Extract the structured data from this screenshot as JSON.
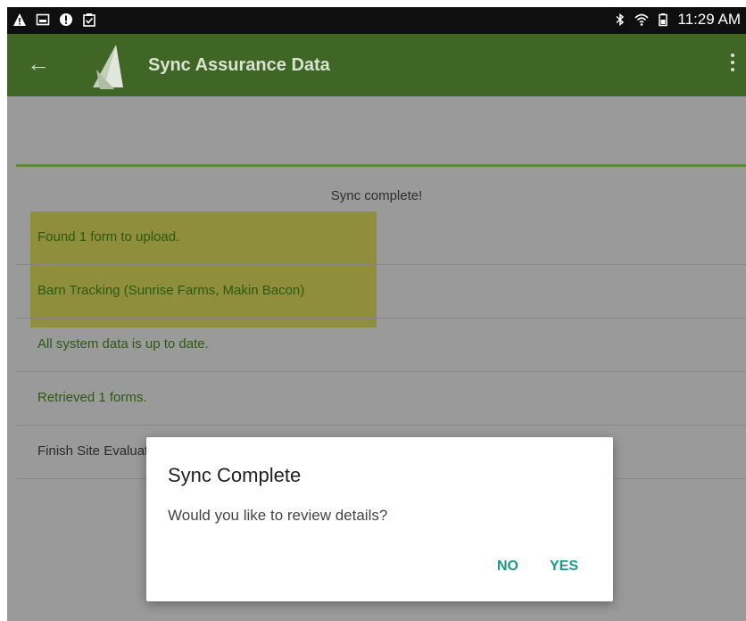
{
  "status_bar": {
    "left_icons": [
      "warning-icon",
      "image-icon",
      "alert-icon",
      "clipboard-icon"
    ],
    "right_icons": [
      "bluetooth-icon",
      "wifi-icon",
      "battery-icon"
    ],
    "time": "11:29 AM"
  },
  "app_bar": {
    "title": "Sync Assurance Data",
    "back_icon": "arrow-back-icon",
    "menu_icon": "overflow-menu-icon"
  },
  "sync_status": "Sync complete!",
  "log_items": [
    {
      "text": "Found 1 form to upload."
    },
    {
      "text": "Barn Tracking  (Sunrise Farms, Makin Bacon)"
    },
    {
      "text": "All system data is up to date."
    },
    {
      "text": "Retrieved 1 forms."
    },
    {
      "text": "Finish Site Evaluation"
    }
  ],
  "dialog": {
    "title": "Sync Complete",
    "message": "Would you like to review details?",
    "no_label": "NO",
    "yes_label": "YES"
  },
  "colors": {
    "app_bar": "#3f6624",
    "status_bar": "#0f0f0f",
    "highlight": "#8e8e3c",
    "accent_button": "#1b9a8a",
    "log_text_green": "#2c5a10"
  }
}
